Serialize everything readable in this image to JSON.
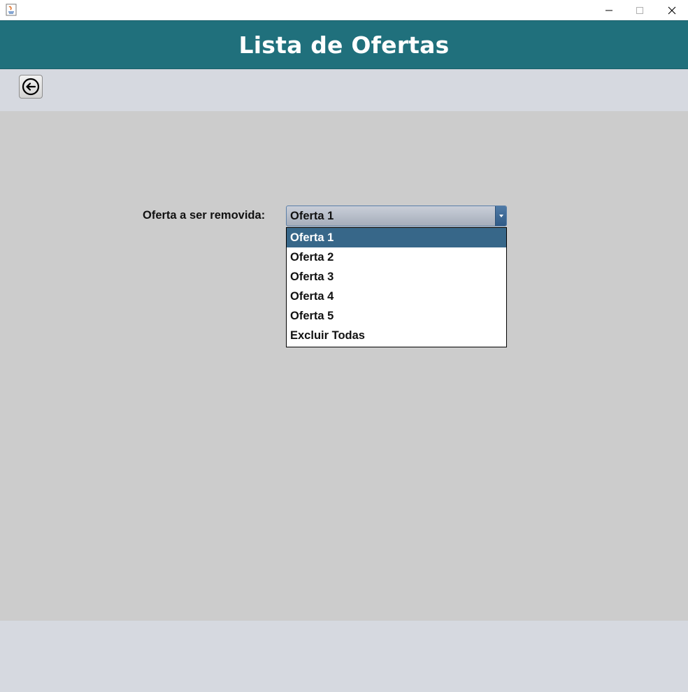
{
  "window": {
    "minimize_glyph": "—",
    "maximize_glyph": "☐",
    "close_glyph": "✕"
  },
  "header": {
    "title": "Lista de Ofertas",
    "color": "#20707c"
  },
  "toolbar": {
    "back_icon": "arrow-left-circle-icon"
  },
  "form": {
    "label": "Oferta a ser removida:",
    "combo": {
      "selected": "Oferta 1",
      "options": [
        "Oferta 1",
        "Oferta 2",
        "Oferta 3",
        "Oferta 4",
        "Oferta 5",
        "Excluir Todas"
      ],
      "highlighted_index": 0,
      "highlight_color": "#376789"
    }
  }
}
